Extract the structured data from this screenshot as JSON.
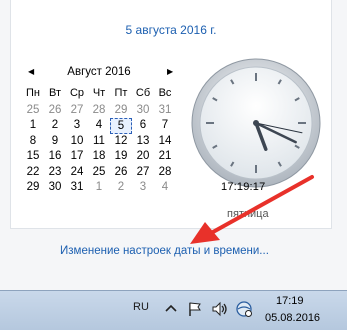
{
  "flyout": {
    "full_date": "5 августа 2016 г.",
    "calendar": {
      "month_title": "Август 2016",
      "weekday_headers": [
        "Пн",
        "Вт",
        "Ср",
        "Чт",
        "Пт",
        "Сб",
        "Вс"
      ],
      "weeks": [
        [
          "25",
          "26",
          "27",
          "28",
          "29",
          "30",
          "31"
        ],
        [
          "1",
          "2",
          "3",
          "4",
          "5",
          "6",
          "7"
        ],
        [
          "8",
          "9",
          "10",
          "11",
          "12",
          "13",
          "14"
        ],
        [
          "15",
          "16",
          "17",
          "18",
          "19",
          "20",
          "21"
        ],
        [
          "22",
          "23",
          "24",
          "25",
          "26",
          "27",
          "28"
        ],
        [
          "29",
          "30",
          "31",
          "1",
          "2",
          "3",
          "4"
        ]
      ],
      "today": "5"
    },
    "time": "17:19:17",
    "weekday": "пятница",
    "settings_link": "Изменение настроек даты и времени...",
    "arrow_color": "#e8312a"
  },
  "taskbar": {
    "language": "RU",
    "time": "17:19",
    "date": "05.08.2016",
    "icons": [
      "chevron-up-icon",
      "flag-icon",
      "volume-icon",
      "network-icon"
    ]
  }
}
